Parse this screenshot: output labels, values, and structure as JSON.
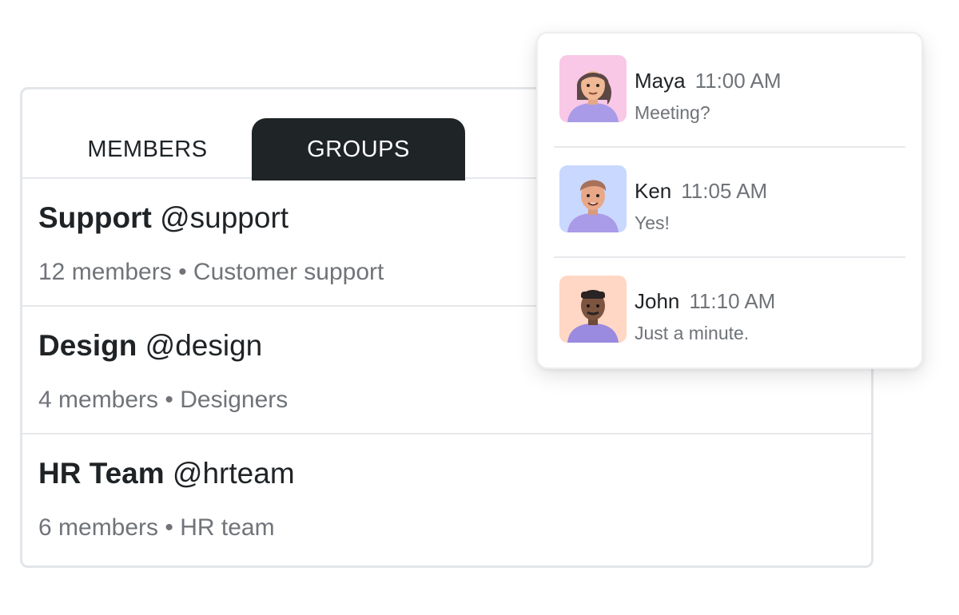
{
  "tabs": {
    "members_label": "MEMBERS",
    "groups_label": "GROUPS",
    "active": "GROUPS"
  },
  "groups": [
    {
      "name": "Support",
      "handle": "@support",
      "meta": "12 members • Customer support"
    },
    {
      "name": "Design",
      "handle": "@design",
      "meta": "4 members • Designers"
    },
    {
      "name": "HR Team",
      "handle": "@hrteam",
      "meta": "6 members • HR team"
    }
  ],
  "messages": [
    {
      "name": "Maya",
      "time": "11:00 AM",
      "text": "Meeting?",
      "avatar_bg": "#f8c8e6"
    },
    {
      "name": "Ken",
      "time": "11:05 AM",
      "text": "Yes!",
      "avatar_bg": "#c9d8ff"
    },
    {
      "name": "John",
      "time": "11:10 AM",
      "text": "Just a minute.",
      "avatar_bg": "#ffd7c4"
    }
  ],
  "colors": {
    "active_tab_bg": "#1f2427",
    "border": "#e2e6ea"
  }
}
